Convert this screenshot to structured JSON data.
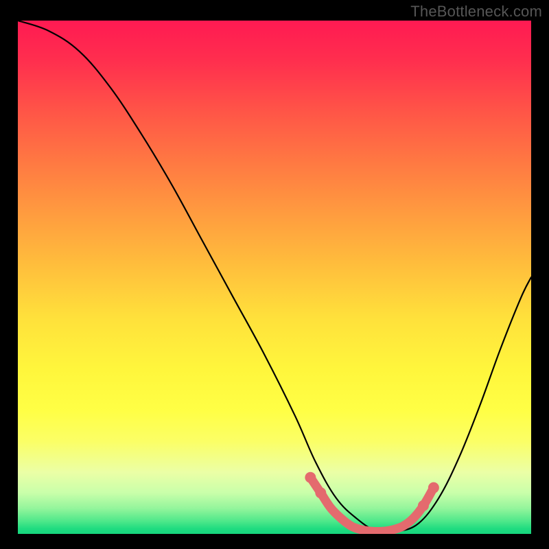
{
  "watermark": "TheBottleneck.com",
  "chart_data": {
    "type": "line",
    "title": "",
    "xlabel": "",
    "ylabel": "",
    "xlim": [
      0,
      100
    ],
    "ylim": [
      0,
      100
    ],
    "grid": false,
    "legend": false,
    "series": [
      {
        "name": "bottleneck-curve",
        "color": "#000000",
        "x": [
          0,
          6,
          12,
          18,
          24,
          30,
          36,
          42,
          48,
          54,
          58,
          62,
          66,
          70,
          74,
          78,
          82,
          86,
          90,
          94,
          98,
          100
        ],
        "values": [
          100,
          98,
          94,
          87,
          78,
          68,
          57,
          46,
          35,
          23,
          14,
          7,
          3,
          0.5,
          0.5,
          2,
          7,
          15,
          25,
          36,
          46,
          50
        ]
      },
      {
        "name": "optimal-region",
        "color": "#e46a6e",
        "x": [
          57,
          59,
          61,
          63,
          65,
          67,
          69,
          71,
          73,
          75,
          77,
          79,
          81
        ],
        "values": [
          11,
          8,
          5,
          3,
          1.5,
          0.8,
          0.5,
          0.5,
          0.8,
          1.5,
          3,
          5.5,
          9
        ]
      }
    ],
    "optimal_markers": {
      "name": "optimal-dots",
      "color": "#e46a6e",
      "x": [
        57,
        59,
        79,
        81
      ],
      "values": [
        11,
        8,
        5.5,
        9
      ]
    },
    "background_gradient": {
      "stops": [
        {
          "pos": 0,
          "color": "#ff1a52"
        },
        {
          "pos": 50,
          "color": "#ffd93c"
        },
        {
          "pos": 80,
          "color": "#fbff66"
        },
        {
          "pos": 100,
          "color": "#16d57d"
        }
      ]
    }
  }
}
